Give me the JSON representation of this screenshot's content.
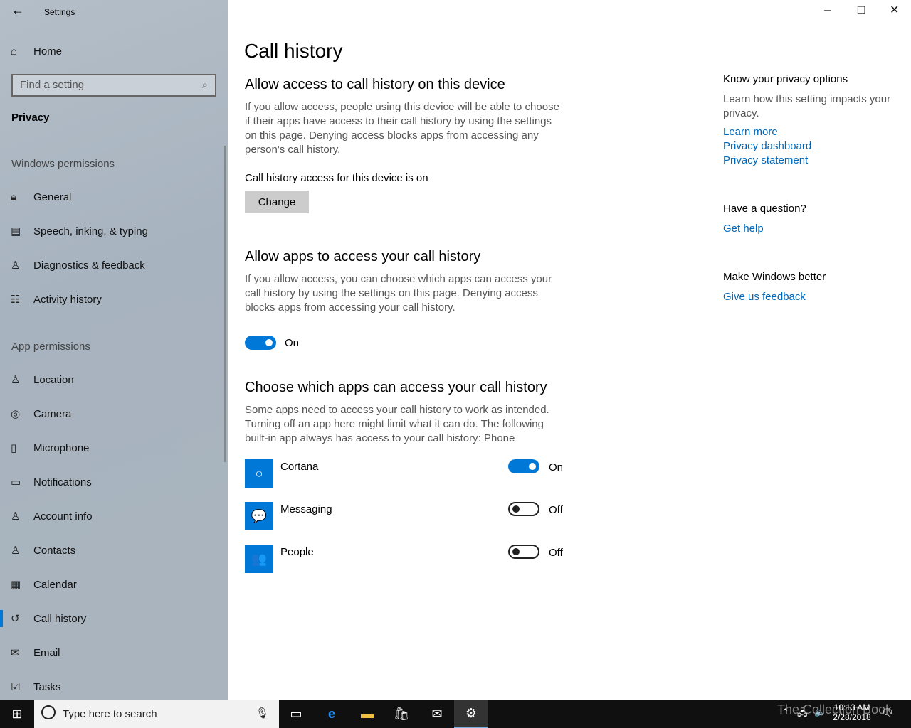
{
  "app": {
    "title": "Settings"
  },
  "sidebar": {
    "home": "Home",
    "search_placeholder": "Find a setting",
    "section": "Privacy",
    "groups": {
      "windows": "Windows permissions",
      "app": "App permissions"
    },
    "windows_items": [
      {
        "label": "General",
        "icon": "lock-icon"
      },
      {
        "label": "Speech, inking, & typing",
        "icon": "speech-icon"
      },
      {
        "label": "Diagnostics & feedback",
        "icon": "diagnostics-icon"
      },
      {
        "label": "Activity history",
        "icon": "activity-icon"
      }
    ],
    "app_items": [
      {
        "label": "Location",
        "icon": "location-icon"
      },
      {
        "label": "Camera",
        "icon": "camera-icon"
      },
      {
        "label": "Microphone",
        "icon": "microphone-icon"
      },
      {
        "label": "Notifications",
        "icon": "notifications-icon"
      },
      {
        "label": "Account info",
        "icon": "account-icon"
      },
      {
        "label": "Contacts",
        "icon": "contacts-icon"
      },
      {
        "label": "Calendar",
        "icon": "calendar-icon"
      },
      {
        "label": "Call history",
        "icon": "history-icon",
        "selected": true
      },
      {
        "label": "Email",
        "icon": "email-icon"
      },
      {
        "label": "Tasks",
        "icon": "tasks-icon"
      }
    ]
  },
  "main": {
    "title": "Call history",
    "s1": {
      "heading": "Allow access to call history on this device",
      "desc": "If you allow access, people using this device will be able to choose if their apps have access to their call history by using the settings on this page. Denying access blocks apps from accessing any person's call history.",
      "status": "Call history access for this device is on",
      "button": "Change"
    },
    "s2": {
      "heading": "Allow apps to access your call history",
      "desc": "If you allow access, you can choose which apps can access your call history by using the settings on this page. Denying access blocks apps from accessing your call history.",
      "toggle_label": "On",
      "toggle_on": true
    },
    "s3": {
      "heading": "Choose which apps can access your call history",
      "desc": "Some apps need to access your call history to work as intended. Turning off an app here might limit what it can do. The following built-in app always has access to your call history: Phone",
      "apps": [
        {
          "name": "Cortana",
          "state": "On",
          "on": true
        },
        {
          "name": "Messaging",
          "state": "Off",
          "on": false
        },
        {
          "name": "People",
          "state": "Off",
          "on": false
        }
      ]
    }
  },
  "right": {
    "privacy_heading": "Know your privacy options",
    "privacy_desc": "Learn how this setting impacts your privacy.",
    "links": [
      "Learn more",
      "Privacy dashboard",
      "Privacy statement"
    ],
    "question_heading": "Have a question?",
    "help_link": "Get help",
    "better_heading": "Make Windows better",
    "feedback_link": "Give us feedback"
  },
  "taskbar": {
    "search_placeholder": "Type here to search",
    "time": "10:13 AM",
    "date": "2/28/2018",
    "watermark": "The Collection Book"
  },
  "colors": {
    "accent": "#0078d7",
    "link": "#0067b8"
  }
}
